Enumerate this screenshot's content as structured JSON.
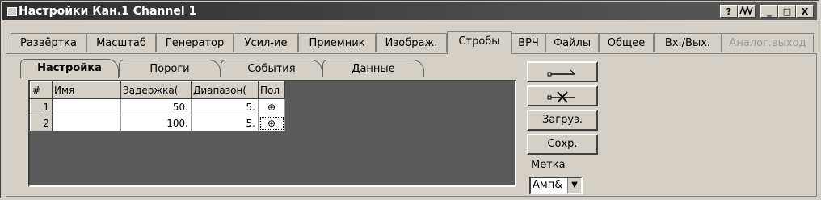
{
  "window": {
    "title": "Настройки Кан.1 Channel 1",
    "controls": [
      "?",
      "/\\/\\",
      "_",
      "□",
      "X"
    ]
  },
  "tabs": [
    {
      "label": "Развёртка"
    },
    {
      "label": "Масштаб"
    },
    {
      "label": "Генератор"
    },
    {
      "label": "Усил-ие"
    },
    {
      "label": "Приемник"
    },
    {
      "label": "Изображ."
    },
    {
      "label": "Стробы",
      "active": true
    },
    {
      "label": "ВРЧ"
    },
    {
      "label": "Файлы"
    },
    {
      "label": "Общее"
    },
    {
      "label": "Вх./Вых."
    },
    {
      "label": "Аналог.выход",
      "disabled": true
    }
  ],
  "subtabs": [
    {
      "label": "Настройка",
      "active": true
    },
    {
      "label": "Пороги"
    },
    {
      "label": "События"
    },
    {
      "label": "Данные"
    }
  ],
  "table": {
    "headers": [
      "#",
      "Имя",
      "Задержка(",
      "Диапазон(",
      "Пол"
    ],
    "rows": [
      {
        "num": "1",
        "name": "",
        "delay": "50.",
        "range": "5.",
        "pol": "⊕"
      },
      {
        "num": "2",
        "name": "",
        "delay": "100.",
        "range": "5.",
        "pol": "⊕"
      }
    ]
  },
  "buttons": {
    "add_icon": "gate-add-icon",
    "remove_icon": "gate-remove-icon",
    "load": "Загруз.",
    "save": "Сохр."
  },
  "label": {
    "metka": "Метка",
    "select_value": "Амп&"
  }
}
